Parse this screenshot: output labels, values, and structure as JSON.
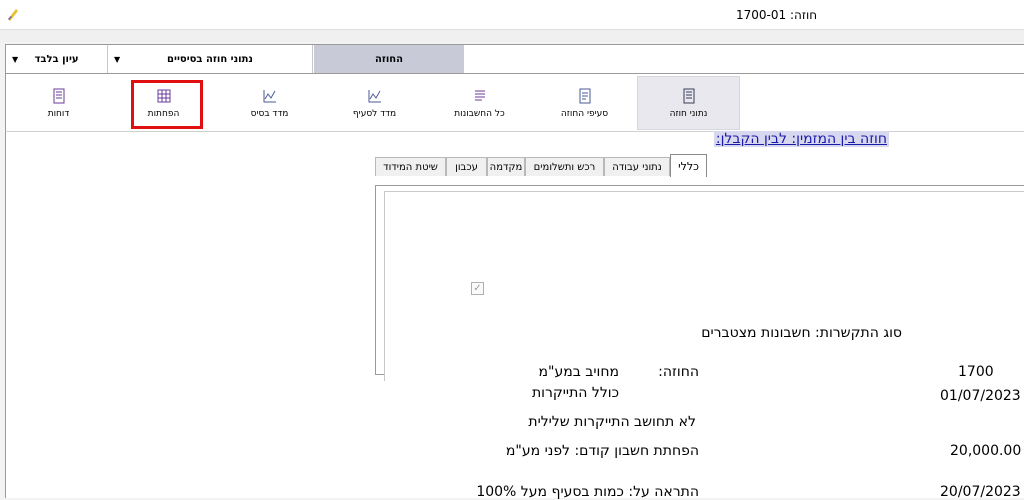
{
  "window": {
    "title": "חוזה: 1700-01"
  },
  "top_tabs": [
    {
      "label": "עיון בלבד",
      "dropdown": true
    },
    {
      "label": "נתוני חוזה בסיסיים",
      "dropdown": true
    },
    {
      "label": "החוזה",
      "active": true
    }
  ],
  "ribbon": {
    "items": [
      {
        "label": "דוחות",
        "icon": "report-icon"
      },
      {
        "label": "הפחתות",
        "icon": "table-icon",
        "highlighted": true
      },
      {
        "label": "מדד בסיס",
        "icon": "chart-icon"
      },
      {
        "label": "מדד לסעיף",
        "icon": "chart-icon"
      },
      {
        "label": "כל החשבונות",
        "icon": "list-icon"
      },
      {
        "label": "סעיפי החוזה",
        "icon": "document-icon"
      },
      {
        "label": "נתוני חוזה",
        "icon": "notebook-icon",
        "selected": true
      }
    ]
  },
  "contract_line": "חוזה בין המזמין:   לבין הקבלן:",
  "sub_tabs": [
    {
      "label": "כללי",
      "active": true
    },
    {
      "label": "נתוני עבודה",
      "highlighted": true
    },
    {
      "label": "רכש ותשלומים"
    },
    {
      "label": "מקדמה",
      "highlighted": true
    },
    {
      "label": "עכבון",
      "highlighted": true
    },
    {
      "label": "שיטת המידוד"
    }
  ],
  "panel": {
    "link_type": "סוג התקשרות: חשבונות מצטברים",
    "contract_label": "החוזה:",
    "contract_value": "מחויב במע\"מ",
    "contract_value2": "כולל התייקרות",
    "contract_number": "1700",
    "start_date": "01/07/2023",
    "checkbox_label": "לא תחושב התייקרות שלילית",
    "checkbox_checked": true,
    "prev_reduction_label": "הפחתת חשבון קודם: לפני מע\"מ",
    "prev_reduction_value": "20,000.00",
    "alert_label": "התראה על: כמות בסעיף מעל 100%",
    "alert_date": "20/07/2023"
  },
  "colors": {
    "highlight_red": "#e01010",
    "active_tab": "#c8cad8",
    "link_blue": "#1a1aa8"
  }
}
